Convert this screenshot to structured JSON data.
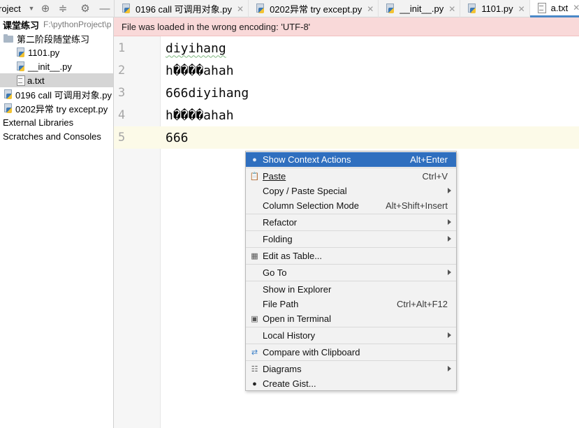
{
  "project_header": {
    "title": "roject"
  },
  "tabs": [
    {
      "label": "0196 call 可调用对象.py",
      "type": "py"
    },
    {
      "label": "0202异常 try except.py",
      "type": "py"
    },
    {
      "label": "__init__.py",
      "type": "py"
    },
    {
      "label": "1101.py",
      "type": "py"
    },
    {
      "label": "a.txt",
      "type": "txt",
      "active": true
    }
  ],
  "tree": {
    "root_label": "课堂练习",
    "root_path": "F:\\pythonProject\\p",
    "folder_label": "第二阶段随堂练习",
    "items": [
      "1101.py",
      "__init__.py",
      "a.txt"
    ],
    "root_files": [
      "0196 call 可调用对象.py",
      "0202异常 try except.py"
    ],
    "external": "External Libraries",
    "scratches": "Scratches and Consoles"
  },
  "banner": {
    "message": "File was loaded in the wrong encoding: 'UTF-8'"
  },
  "editor": {
    "line_numbers": [
      "1",
      "2",
      "3",
      "4",
      "5"
    ],
    "lines": [
      "diyihang",
      "h����ahah",
      "666diyihang",
      "h����ahah",
      "666"
    ]
  },
  "context_menu": {
    "show_context_actions": {
      "label": "Show Context Actions",
      "shortcut": "Alt+Enter"
    },
    "paste": {
      "label": "Paste",
      "shortcut": "Ctrl+V"
    },
    "copy_paste_special": {
      "label": "Copy / Paste Special"
    },
    "column_selection": {
      "label": "Column Selection Mode",
      "shortcut": "Alt+Shift+Insert"
    },
    "refactor": {
      "label": "Refactor"
    },
    "folding": {
      "label": "Folding"
    },
    "edit_as_table": {
      "label": "Edit as Table..."
    },
    "go_to": {
      "label": "Go To"
    },
    "show_in_explorer": {
      "label": "Show in Explorer"
    },
    "file_path": {
      "label": "File Path",
      "shortcut": "Ctrl+Alt+F12"
    },
    "open_in_terminal": {
      "label": "Open in Terminal"
    },
    "local_history": {
      "label": "Local History"
    },
    "compare_clipboard": {
      "label": "Compare with Clipboard"
    },
    "diagrams": {
      "label": "Diagrams"
    },
    "create_gist": {
      "label": "Create Gist..."
    }
  },
  "colors": {
    "accent": "#2f6fbf",
    "banner_bg": "#f9d9d9",
    "current_line": "#fcfae8"
  }
}
